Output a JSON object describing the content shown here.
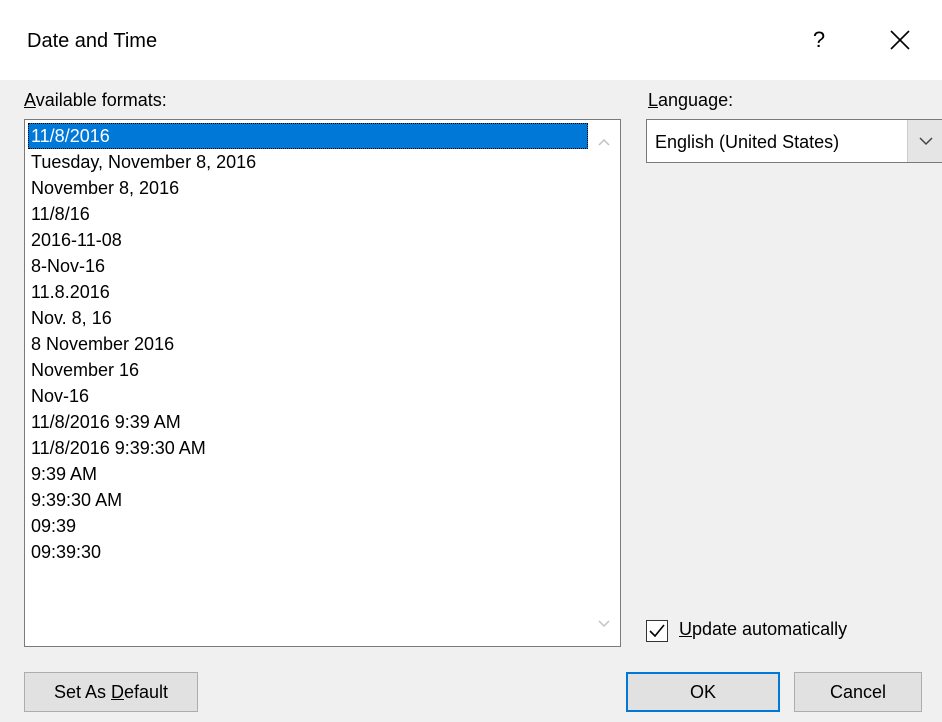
{
  "window": {
    "title": "Date and Time",
    "help_label": "?"
  },
  "formats": {
    "label_underlined": "A",
    "label_rest": "vailable formats:",
    "selected_index": 0,
    "items": [
      "11/8/2016",
      "Tuesday, November 8, 2016",
      "November 8, 2016",
      "11/8/16",
      "2016-11-08",
      "8-Nov-16",
      "11.8.2016",
      "Nov. 8, 16",
      "8 November 2016",
      "November 16",
      "Nov-16",
      "11/8/2016 9:39 AM",
      "11/8/2016 9:39:30 AM",
      "9:39 AM",
      "9:39:30 AM",
      "09:39",
      "09:39:30"
    ]
  },
  "language": {
    "label_underlined": "L",
    "label_rest": "anguage:",
    "value": "English (United States)"
  },
  "update_automatically": {
    "checked": true,
    "label_underlined": "U",
    "label_rest": "pdate automatically"
  },
  "buttons": {
    "set_default_prefix": "Set As ",
    "set_default_underlined": "D",
    "set_default_rest": "efault",
    "ok": "OK",
    "cancel": "Cancel"
  },
  "colors": {
    "selection": "#0078d7",
    "dialog_bg": "#f0f0f0",
    "title_bg": "#ffffff"
  }
}
